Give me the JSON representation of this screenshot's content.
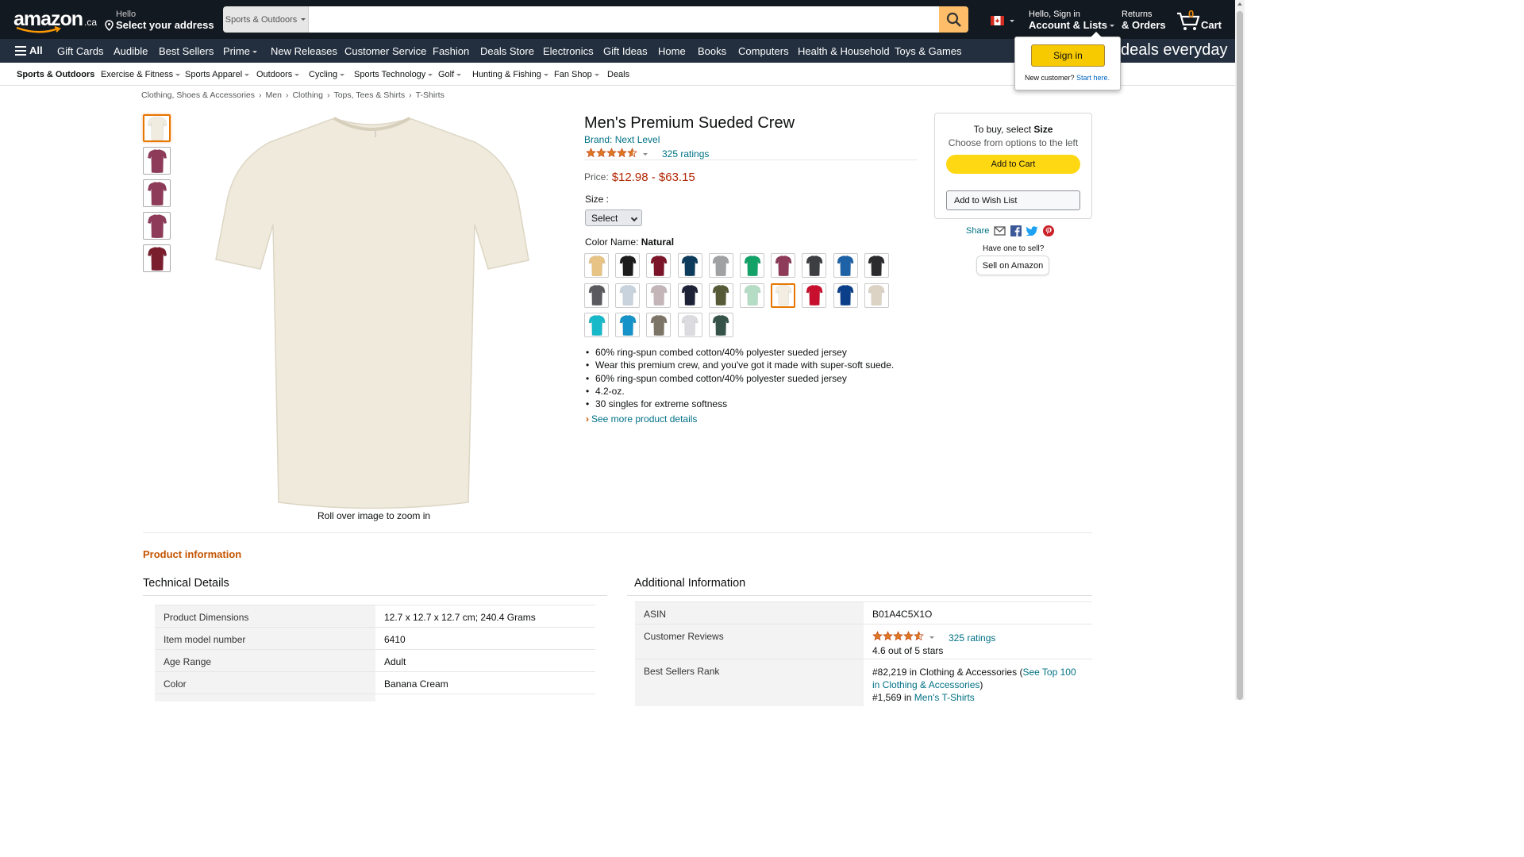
{
  "header": {
    "logo": "amazon",
    "logo_tld": ".ca",
    "address_line1": "Hello",
    "address_line2": "Select your address",
    "search_category": "Sports & Outdoors",
    "search_placeholder": "",
    "account_line1": "Hello, Sign in",
    "account_line2": "Account & Lists",
    "returns_line1": "Returns",
    "returns_line2": "& Orders",
    "cart_count": "0",
    "cart_label": "Cart"
  },
  "main_nav": {
    "all": "All",
    "items": [
      "Gift Cards",
      "Audible",
      "Best Sellers",
      "Prime",
      "New Releases",
      "Customer Service",
      "Fashion",
      "Deals Store",
      "Electronics",
      "Gift Ideas",
      "Home",
      "Books",
      "Computers",
      "Health & Household",
      "Toys & Games"
    ],
    "banner": "deals everyday"
  },
  "sub_nav": {
    "items": [
      "Sports & Outdoors",
      "Exercise & Fitness",
      "Sports Apparel",
      "Outdoors",
      "Cycling",
      "Sports Technology",
      "Golf",
      "Hunting & Fishing",
      "Fan Shop",
      "Deals"
    ]
  },
  "flyout": {
    "signin": "Sign in",
    "new_customer": "New customer?",
    "start_here": "Start here."
  },
  "breadcrumb": [
    "Clothing, Shoes & Accessories",
    "Men",
    "Clothing",
    "Tops, Tees & Shirts",
    "T-Shirts"
  ],
  "product": {
    "title": "Men's Premium Sueded Crew",
    "brand": "Brand: Next Level",
    "rating": 4.6,
    "ratings_count": "325 ratings",
    "price_label": "Price:",
    "price": "$12.98 - $63.15",
    "size_label": "Size :",
    "size_value": "Select",
    "color_label": "Color Name:",
    "color_value": "Natural",
    "zoom_hint": "Roll over image to zoom in",
    "bullets": [
      "60% ring-spun combed cotton/40% polyester sueded jersey",
      "Wear this premium crew, and you've got it made with super-soft suede.",
      "60% ring-spun combed cotton/40% polyester sueded jersey",
      "4.2-oz.",
      "30 singles for extreme softness"
    ],
    "see_more": "See more product details",
    "thumb_colors": [
      "#f1ece0",
      "#8e3a59",
      "#8e3a59",
      "#8e3a59",
      "#7a1e2e"
    ],
    "main_color": "#efeadc",
    "swatches": [
      "#e7c485",
      "#1c1c1c",
      "#7b1428",
      "#0d3b5c",
      "#9fa1a3",
      "#12a267",
      "#8e3a59",
      "#3d3e42",
      "#1d62a6",
      "#2b2b2e",
      "#5b5b5f",
      "#c8d3de",
      "#c4b5b9",
      "#1e2237",
      "#565a36",
      "#b5dcc5",
      "#f3eee1",
      "#c8102e",
      "#0b3f8a",
      "#ddd3c5",
      "#17b9c9",
      "#1592c8",
      "#7c7466",
      "#dcdbe0",
      "#36534a"
    ],
    "selected_swatch": 16
  },
  "buybox": {
    "line1_pre": "To buy, select ",
    "line1_bold": "Size",
    "line2": "Choose from options to the left",
    "add_to_cart": "Add to Cart",
    "add_to_wishlist": "Add to Wish List",
    "share": "Share",
    "have_one": "Have one to sell?",
    "sell_on_amazon": "Sell on Amazon"
  },
  "product_info": {
    "heading": "Product information",
    "technical_title": "Technical Details",
    "technical": [
      {
        "k": "Product Dimensions",
        "v": "12.7 x 12.7 x 12.7 cm; 240.4 Grams"
      },
      {
        "k": "Item model number",
        "v": "6410"
      },
      {
        "k": "Age Range",
        "v": "Adult"
      },
      {
        "k": "Color",
        "v": "Banana Cream"
      }
    ],
    "additional_title": "Additional Information",
    "asin_label": "ASIN",
    "asin": "B01A4C5X1O",
    "reviews_label": "Customer Reviews",
    "reviews_count": "325 ratings",
    "reviews_text": "4.6 out of 5 stars",
    "rank_label": "Best Sellers Rank",
    "rank_1_pre": "#82,219 in Clothing & Accessories (",
    "rank_1_link": "See Top 100 in Clothing & Accessories",
    "rank_1_post": ")",
    "rank_2_pre": "#1,569 in ",
    "rank_2_link": "Men's T-Shirts"
  },
  "colors": {
    "nav_dark": "#131921",
    "nav_mid": "#232f3e",
    "accent": "#febd69",
    "price": "#b12704",
    "link": "#007185",
    "star": "#de7921",
    "cart_button": "#ffd814"
  }
}
